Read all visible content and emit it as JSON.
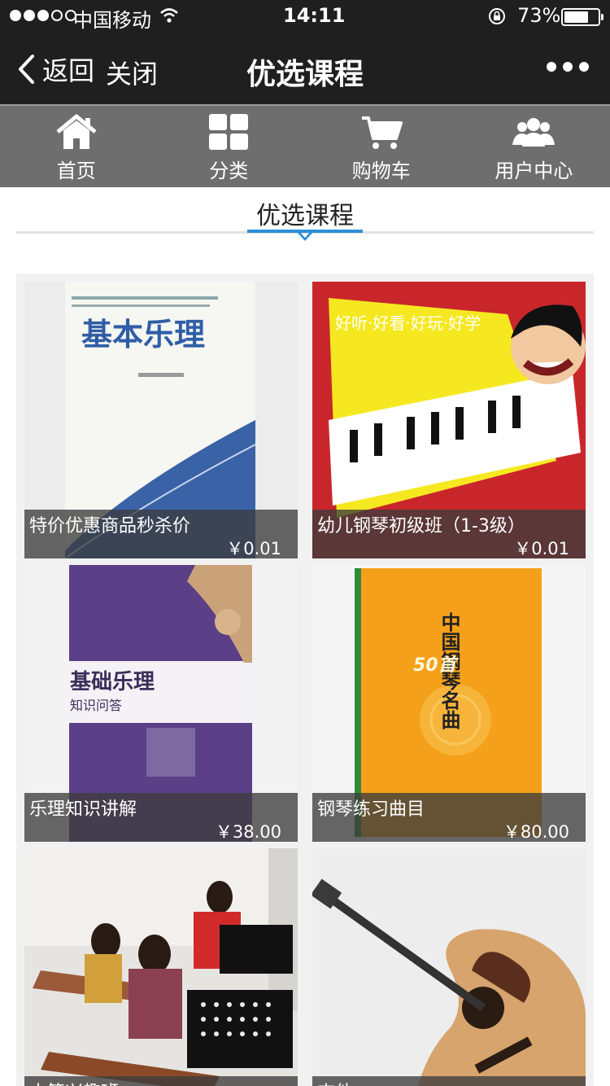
{
  "status_bar": {
    "carrier": "中国移动",
    "time": "14:11",
    "battery_percent_label": "73%",
    "battery_level": 0.73
  },
  "nav": {
    "back_label": "返回",
    "close_label": "关闭",
    "title": "优选课程"
  },
  "tabs": [
    {
      "label": "首页",
      "icon": "home-icon"
    },
    {
      "label": "分类",
      "icon": "grid-icon"
    },
    {
      "label": "购物车",
      "icon": "cart-icon"
    },
    {
      "label": "用户中心",
      "icon": "users-icon"
    }
  ],
  "section": {
    "title": "优选课程",
    "accent": "#2e8fd8"
  },
  "products": [
    {
      "name": "特价优惠商品秒杀价",
      "price": "￥0.01",
      "cover_text": "基本乐理"
    },
    {
      "name": "幼儿钢琴初级班（1-3级）",
      "price": "￥0.01",
      "cover_text": "好听·好看·好玩·好学"
    },
    {
      "name": "乐理知识讲解",
      "price": "￥38.00",
      "cover_text": "基础乐理",
      "cover_subtext": "知识问答"
    },
    {
      "name": "钢琴练习曲目",
      "price": "￥80.00",
      "cover_text": "中国钢琴名曲",
      "cover_subtext": "50首"
    },
    {
      "name": "古筝兴趣班",
      "price": ""
    },
    {
      "name": "吉他",
      "price": ""
    }
  ]
}
